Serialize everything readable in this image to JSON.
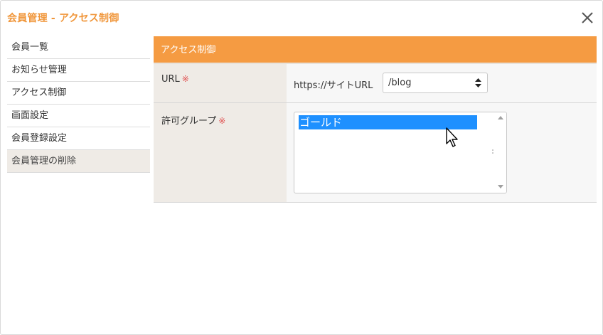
{
  "dialog": {
    "title": "会員管理 - アクセス制御",
    "close_icon": "close-icon",
    "accent_color": "#f59b42"
  },
  "sidebar": {
    "items": [
      {
        "label": "会員一覧"
      },
      {
        "label": "お知らせ管理"
      },
      {
        "label": "アクセス制御"
      },
      {
        "label": "画面設定"
      },
      {
        "label": "会員登録設定"
      },
      {
        "label": "会員管理の削除",
        "active": true
      }
    ]
  },
  "section": {
    "header": "アクセス制御"
  },
  "form": {
    "url": {
      "label": "URL",
      "required_mark": "※",
      "prefix": "https://サイトURL",
      "selected_value": "/blog"
    },
    "group": {
      "label": "許可グループ",
      "required_mark": "※",
      "options": [
        "ゴールド"
      ],
      "selected": "ゴールド"
    }
  }
}
